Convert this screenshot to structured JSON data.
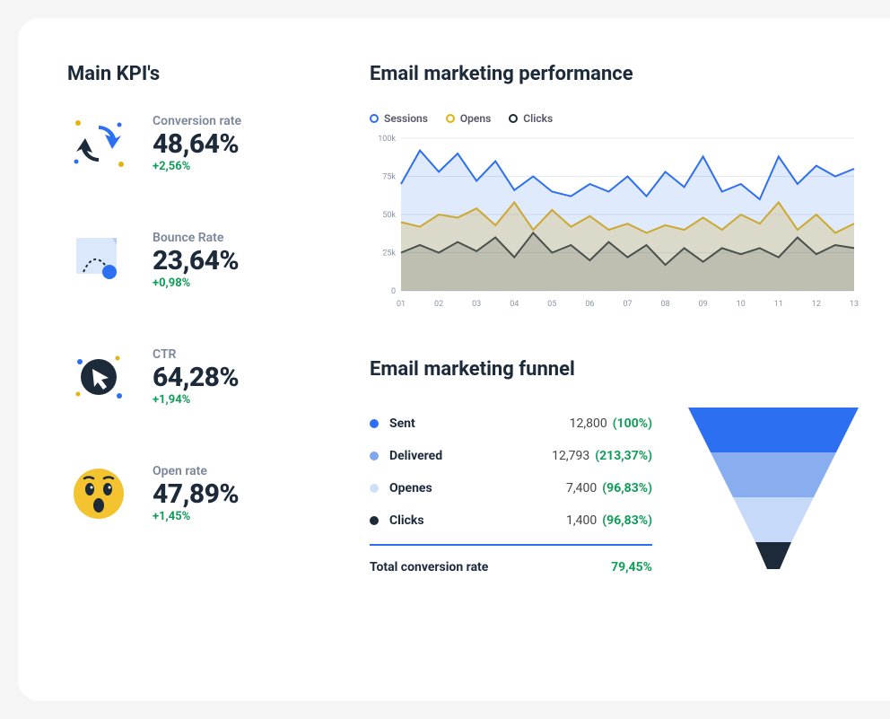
{
  "kpi_section": {
    "title": "Main KPI's",
    "items": [
      {
        "label": "Conversion rate",
        "value": "48,64%",
        "delta": "+2,56%"
      },
      {
        "label": "Bounce Rate",
        "value": "23,64%",
        "delta": "+0,98%"
      },
      {
        "label": "CTR",
        "value": "64,28%",
        "delta": "+1,94%"
      },
      {
        "label": "Open rate",
        "value": "47,89%",
        "delta": "+1,45%"
      }
    ]
  },
  "performance": {
    "title": "Email marketing performance",
    "legend": {
      "sessions": "Sessions",
      "opens": "Opens",
      "clicks": "Clicks"
    }
  },
  "funnel": {
    "title": "Email marketing funnel",
    "rows": [
      {
        "name": "Sent",
        "value": "12,800",
        "pct": "(100%)",
        "color": "#2d6ff1"
      },
      {
        "name": "Delivered",
        "value": "12,793",
        "pct": "(213,37%)",
        "color": "#7fa6ee"
      },
      {
        "name": "Openes",
        "value": "7,400",
        "pct": "(96,83%)",
        "color": "#cfe0fb"
      },
      {
        "name": "Clicks",
        "value": "1,400",
        "pct": "(96,83%)",
        "color": "#1c2a3a"
      }
    ],
    "total_label": "Total conversion rate",
    "total_value": "79,45%"
  },
  "chart_data": {
    "type": "area",
    "title": "Email marketing performance",
    "ylabel": "",
    "xlabel": "",
    "ylim": [
      0,
      100
    ],
    "y_ticks": [
      "0",
      "25k",
      "50k",
      "75k",
      "100k"
    ],
    "categories": [
      "01",
      "02",
      "03",
      "04",
      "05",
      "06",
      "07",
      "08",
      "09",
      "10",
      "11",
      "12",
      "13"
    ],
    "series": [
      {
        "name": "Sessions",
        "color": "#2d6ff1",
        "values": [
          70,
          92,
          78,
          90,
          72,
          85,
          66,
          75,
          65,
          62,
          70,
          65,
          75,
          62,
          78,
          68,
          88,
          65,
          70,
          60,
          88,
          70,
          82,
          75,
          80
        ]
      },
      {
        "name": "Opens",
        "color": "#e8b20e",
        "values": [
          45,
          42,
          50,
          48,
          54,
          43,
          58,
          40,
          53,
          42,
          49,
          40,
          44,
          38,
          43,
          40,
          48,
          40,
          50,
          44,
          58,
          40,
          50,
          38,
          44
        ]
      },
      {
        "name": "Clicks",
        "color": "#1c2a3a",
        "values": [
          25,
          30,
          25,
          32,
          26,
          35,
          22,
          38,
          25,
          30,
          20,
          32,
          22,
          30,
          17,
          28,
          19,
          28,
          24,
          28,
          22,
          35,
          24,
          30,
          28
        ]
      }
    ]
  }
}
